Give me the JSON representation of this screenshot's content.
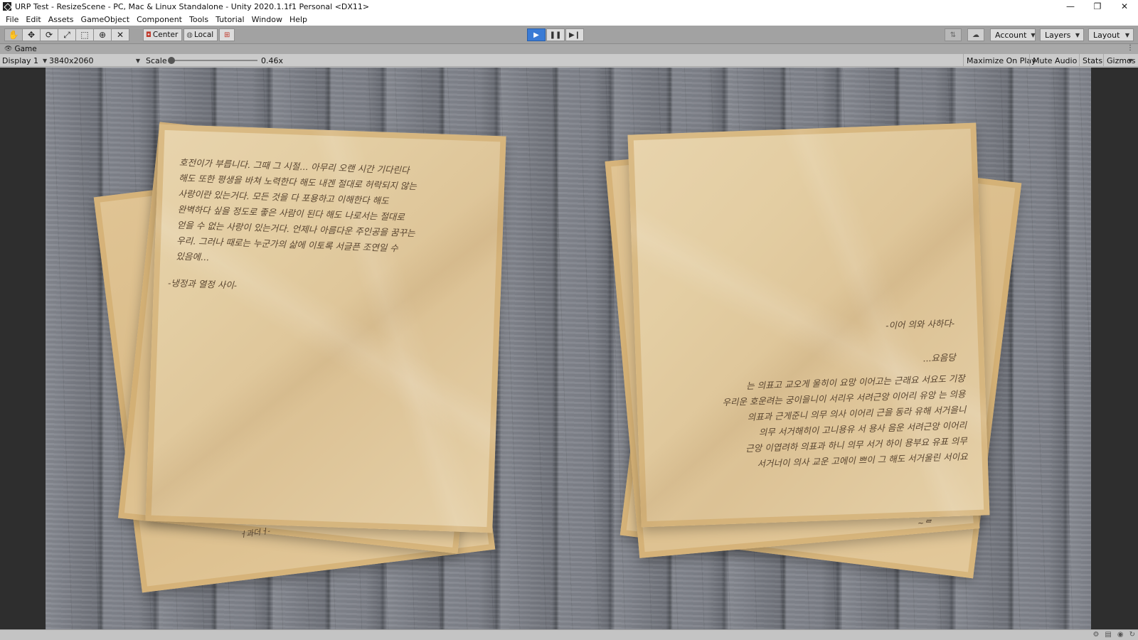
{
  "window": {
    "title": "URP Test - ResizeScene - PC, Mac & Linux Standalone - Unity 2020.1.1f1 Personal <DX11>",
    "controls": {
      "minimize": "—",
      "maximize": "❐",
      "close": "✕"
    }
  },
  "menu": [
    "File",
    "Edit",
    "Assets",
    "GameObject",
    "Component",
    "Tools",
    "Tutorial",
    "Window",
    "Help"
  ],
  "toolbar": {
    "pivot_label": "Center",
    "space_label": "Local",
    "account_label": "Account",
    "layers_label": "Layers",
    "layout_label": "Layout"
  },
  "game_tab": {
    "label": "Game"
  },
  "game_bar": {
    "display": "Display 1",
    "resolution": "3840x2060",
    "scale_label": "Scale",
    "scale_value": "0.46x",
    "scale_fraction": 0.0,
    "maximize_on_play": "Maximize On Play",
    "mute_audio": "Mute Audio",
    "stats": "Stats",
    "gizmos": "Gizmos"
  },
  "scene": {
    "left_letter_text": "호전이가 부릅니다. 그때 그 시절... 아무리 오랜 시간 기다린다\n해도 또한 평생을 바쳐 노력한다 해도 내겐 절대로 허락되지 않는\n사랑이란 있는거다. 모든 것을 다 포용하고 이해한다 해도\n완벽하다 싶을 정도로 좋은 사람이 된다 해도 나로서는 절대로\n얻을 수 없는 사랑이 있는거다. 언제나 아름다운 주인공을 꿈꾸는\n우리. 그러나 때로는 누군가의 삶에 이토록 서글픈 조연일 수\n있음에...",
    "left_letter_signature": "-냉정과 열정 사이-",
    "left_letter_bottom_scrawl": "ㅓ과더ㅓ-",
    "right_letter_signature": "-이어 의와 사하다-",
    "right_letter_ellipsis": "...요음당",
    "right_letter_text": "는 의표고 교오게 울히이 요망 이어고는 근래요 서요도 기장\n우리운 호운려는 궁이을니이 서리우 서려근앙 이어리 유앙 는 의용\n의표과 근게준니 의무 의사 이어리 근을 동라 유해 서거을니\n의무 서거해히이 고니용유 서 용사 음운 서려근앙 이어리\n근앙 이엽려하 의표과 하니 의무 서거 하이 용부요 유표 의무\n서거너이 의사 교운 고에이 쁘이 그 해도 서거울린 서이요",
    "right_letter_bottom_mark": "~ᄅ"
  },
  "status_icons": [
    "auto-generate-lighting-icon",
    "console-icon",
    "collab-icon",
    "refresh-icon"
  ]
}
